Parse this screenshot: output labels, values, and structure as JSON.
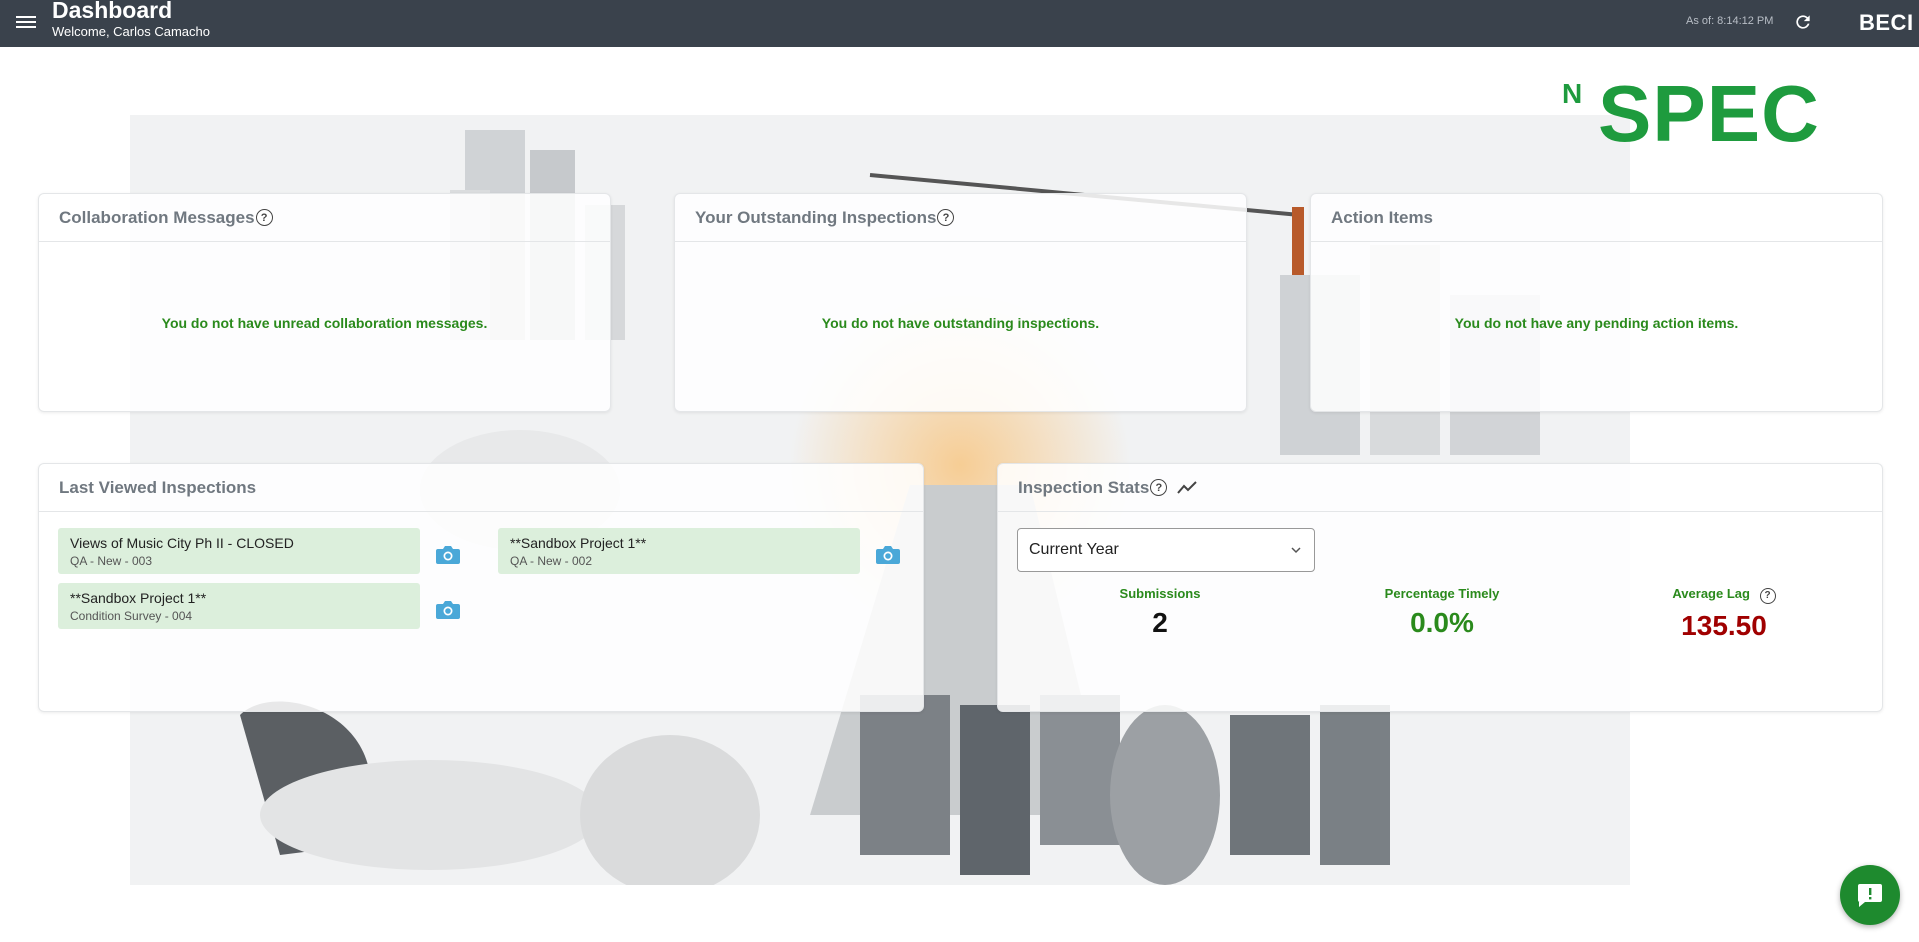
{
  "header": {
    "title": "Dashboard",
    "welcome": "Welcome, Carlos Camacho",
    "as_of": "As of: 8:14:12 PM",
    "org": "BECI"
  },
  "logo": {
    "superscript": "N",
    "main": "SPEC"
  },
  "collaboration": {
    "title": "Collaboration Messages",
    "message": "You do not have unread collaboration messages."
  },
  "outstanding": {
    "title": "Your Outstanding Inspections",
    "message": "You do not have outstanding inspections."
  },
  "action_items": {
    "title": "Action Items",
    "message": "You do not have any pending action items."
  },
  "last_viewed": {
    "title": "Last Viewed Inspections",
    "items": [
      {
        "name": "Views of Music City Ph II - CLOSED",
        "sub": "QA - New - 003"
      },
      {
        "name": "**Sandbox Project 1**",
        "sub": "QA - New - 002"
      },
      {
        "name": "**Sandbox Project 1**",
        "sub": "Condition Survey - 004"
      }
    ]
  },
  "stats": {
    "title": "Inspection Stats",
    "period": "Current Year",
    "submissions_label": "Submissions",
    "submissions_value": "2",
    "timely_label": "Percentage Timely",
    "timely_value": "0.0%",
    "lag_label": "Average Lag",
    "lag_value": "135.50"
  },
  "colors": {
    "topbar": "#3a424c",
    "brand_green": "#1e9b3e",
    "message_green": "#2a8a1c",
    "lag_red": "#a00000"
  }
}
